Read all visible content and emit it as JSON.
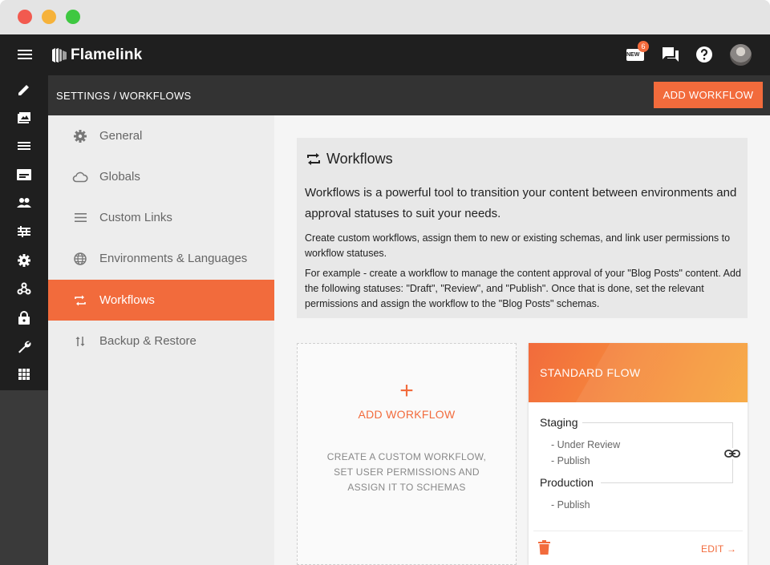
{
  "app": {
    "name": "Flamelink"
  },
  "topbar": {
    "notification_count": "6",
    "new_label": "NEW",
    "icons": [
      "menu-icon",
      "new-icon",
      "chat-icon",
      "help-icon",
      "avatar"
    ]
  },
  "subbar": {
    "breadcrumb": "SETTINGS / WORKFLOWS",
    "add_button": "ADD WORKFLOW"
  },
  "rail": {
    "icons": [
      "pencil-icon",
      "media-icon",
      "menu-list-icon",
      "forms-icon",
      "users-icon",
      "sliders-icon",
      "gear-icon",
      "webhooks-icon",
      "lock-icon",
      "wrench-icon",
      "apps-icon"
    ]
  },
  "nav": {
    "items": [
      {
        "label": "General",
        "icon": "gear-icon"
      },
      {
        "label": "Globals",
        "icon": "cloud-icon"
      },
      {
        "label": "Custom Links",
        "icon": "menu-icon"
      },
      {
        "label": "Environments & Languages",
        "icon": "globe-icon"
      },
      {
        "label": "Workflows",
        "icon": "workflow-icon",
        "active": true
      },
      {
        "label": "Backup & Restore",
        "icon": "swap-vertical-icon"
      }
    ]
  },
  "info": {
    "title": "Workflows",
    "lead": "Workflows is a powerful tool to transition your content between environments and approval statuses to suit your needs.",
    "p1": "Create custom workflows, assign them to new or existing schemas, and link user permissions to workflow statuses.",
    "p2": "For example - create a workflow to manage the content approval of your \"Blog Posts\" content. Add the following statuses: \"Draft\", \"Review\", and \"Publish\". Once that is done, set the relevant permissions and assign the workflow to the \"Blog Posts\" schemas."
  },
  "add_card": {
    "plus": "+",
    "label": "ADD WORKFLOW",
    "description": "CREATE A CUSTOM WORKFLOW, SET USER PERMISSIONS AND ASSIGN IT TO SCHEMAS"
  },
  "flow_card": {
    "title": "STANDARD FLOW",
    "environments": [
      {
        "name": "Staging",
        "statuses": [
          "- Under Review",
          "- Publish"
        ]
      },
      {
        "name": "Production",
        "statuses": [
          "- Publish"
        ]
      }
    ],
    "edit_label": "EDIT →"
  },
  "colors": {
    "accent": "#f26b3c",
    "topbar": "#1f1f1f",
    "subbar": "#333333",
    "panel": "#ededed"
  }
}
